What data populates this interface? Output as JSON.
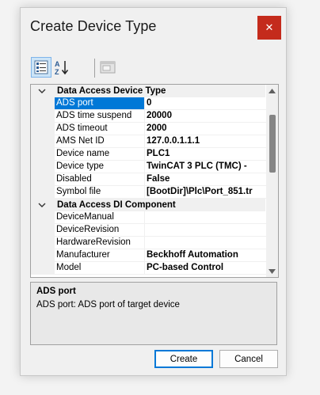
{
  "dialog": {
    "title": "Create Device Type",
    "close_glyph": "✕"
  },
  "toolbar": {
    "items": [
      {
        "icon": "categorized-view-icon",
        "active": true
      },
      {
        "icon": "alphabetical-sort-icon",
        "active": false
      },
      {
        "icon": "property-pages-icon",
        "active": false
      }
    ]
  },
  "property_grid": {
    "categories": [
      {
        "label": "Data Access Device Type",
        "properties": [
          {
            "name": "ADS port",
            "value": "0"
          },
          {
            "name": "ADS time suspend",
            "value": "20000"
          },
          {
            "name": "ADS timeout",
            "value": "2000"
          },
          {
            "name": "AMS Net ID",
            "value": "127.0.0.1.1.1"
          },
          {
            "name": "Device name",
            "value": "PLC1"
          },
          {
            "name": "Device type",
            "value": "TwinCAT 3 PLC (TMC) -"
          },
          {
            "name": "Disabled",
            "value": "False"
          },
          {
            "name": "Symbol file",
            "value": "[BootDir]\\Plc\\Port_851.tr"
          }
        ]
      },
      {
        "label": "Data Access DI Component",
        "properties": [
          {
            "name": "DeviceManual",
            "value": ""
          },
          {
            "name": "DeviceRevision",
            "value": ""
          },
          {
            "name": "HardwareRevision",
            "value": ""
          },
          {
            "name": "Manufacturer",
            "value": "Beckhoff Automation"
          },
          {
            "name": "Model",
            "value": "PC-based Control"
          }
        ]
      }
    ],
    "selected_property": "ADS port"
  },
  "description": {
    "title": "ADS port",
    "text": "ADS port: ADS port of target device"
  },
  "buttons": {
    "create_label": "Create",
    "cancel_label": "Cancel"
  },
  "colors": {
    "selection": "#0078d7",
    "close_button": "#c42b1c",
    "category_bg": "#f0f0f0"
  }
}
